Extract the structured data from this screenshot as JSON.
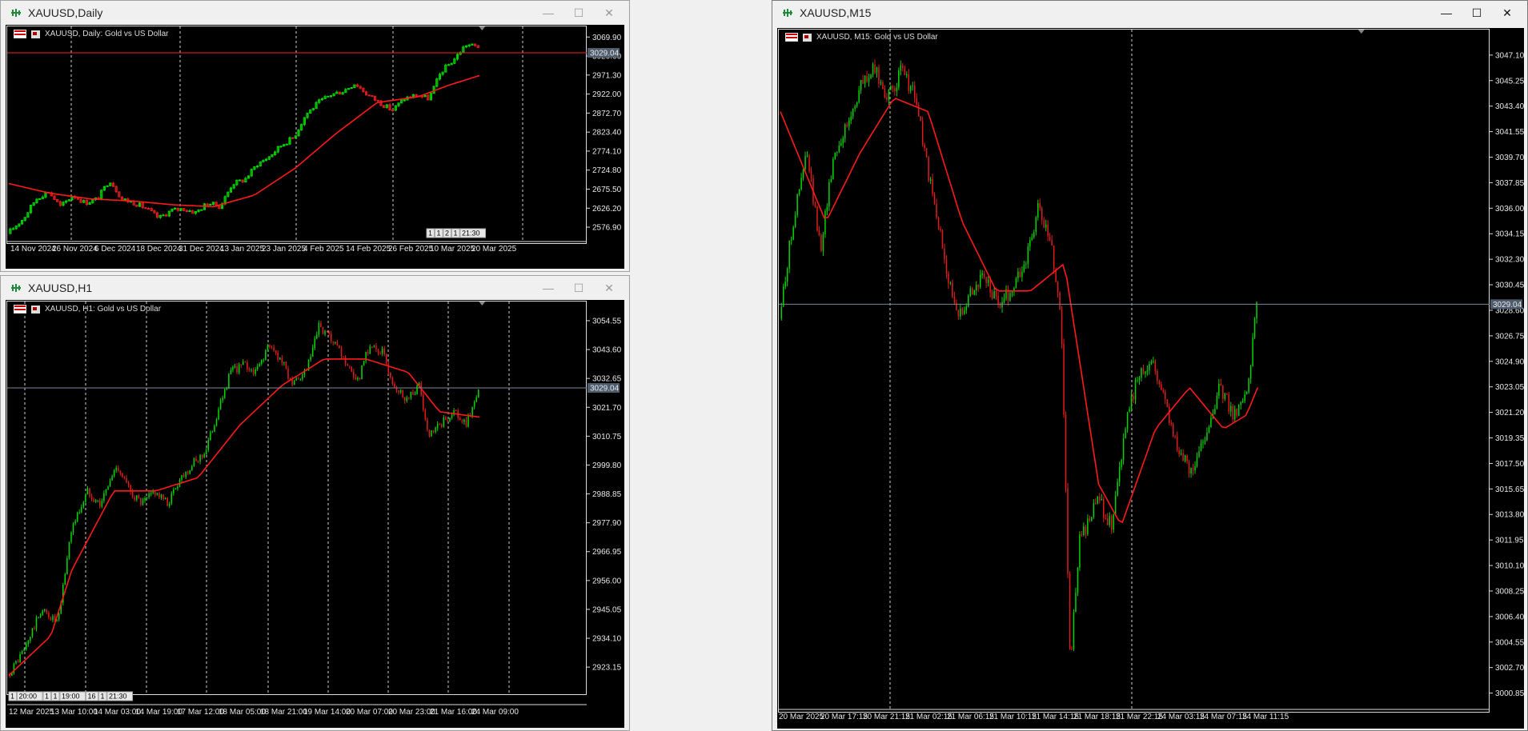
{
  "colors": {
    "bull": "#00d600",
    "bear": "#e21c1c",
    "ma": "#ff1a1a",
    "grid": "#d0d0d0",
    "price_line": "#7a8899",
    "price_box": "#4d5d6e"
  },
  "windows": [
    {
      "id": "daily",
      "title": "XAUUSD,Daily",
      "header": "XAUUSD, Daily:  Gold vs US Dollar",
      "active": false,
      "y_min": 2550,
      "y_max": 3085,
      "y_ticks": [
        "3069.90",
        "3020.60",
        "2971.30",
        "2922.00",
        "2872.70",
        "2823.40",
        "2774.10",
        "2724.80",
        "2675.50",
        "2626.20",
        "2576.90"
      ],
      "current_price": "3029.04",
      "price_line_color": "#ff2020",
      "x_labels": [
        "14 Nov 2024",
        "26 Nov 2024",
        "6 Dec 2024",
        "18 Dec 2024",
        "31 Dec 2024",
        "13 Jan 2025",
        "23 Jan 2025",
        "4 Feb 2025",
        "14 Feb 2025",
        "26 Feb 2025",
        "10 Mar 2025",
        "20 Mar 2025"
      ],
      "period_separators": [
        "1",
        "1",
        "2",
        "1",
        "21:30"
      ],
      "path": [
        [
          0,
          2560
        ],
        [
          8,
          2600
        ],
        [
          14,
          2650
        ],
        [
          20,
          2670
        ],
        [
          26,
          2630
        ],
        [
          32,
          2660
        ],
        [
          38,
          2640
        ],
        [
          44,
          2650
        ],
        [
          50,
          2700
        ],
        [
          56,
          2650
        ],
        [
          62,
          2640
        ],
        [
          68,
          2625
        ],
        [
          74,
          2600
        ],
        [
          80,
          2620
        ],
        [
          86,
          2625
        ],
        [
          92,
          2615
        ],
        [
          98,
          2640
        ],
        [
          104,
          2630
        ],
        [
          110,
          2690
        ],
        [
          116,
          2700
        ],
        [
          122,
          2740
        ],
        [
          128,
          2760
        ],
        [
          134,
          2790
        ],
        [
          140,
          2810
        ],
        [
          146,
          2870
        ],
        [
          152,
          2900
        ],
        [
          158,
          2920
        ],
        [
          164,
          2930
        ],
        [
          170,
          2950
        ],
        [
          176,
          2920
        ],
        [
          182,
          2900
        ],
        [
          188,
          2880
        ],
        [
          194,
          2910
        ],
        [
          200,
          2920
        ],
        [
          206,
          2910
        ],
        [
          212,
          2980
        ],
        [
          218,
          3010
        ],
        [
          224,
          3050
        ],
        [
          230,
          3045
        ]
      ],
      "ma_path": [
        [
          0,
          2690
        ],
        [
          20,
          2665
        ],
        [
          40,
          2650
        ],
        [
          60,
          2645
        ],
        [
          80,
          2635
        ],
        [
          100,
          2630
        ],
        [
          120,
          2660
        ],
        [
          140,
          2730
        ],
        [
          160,
          2820
        ],
        [
          180,
          2900
        ],
        [
          200,
          2915
        ],
        [
          215,
          2945
        ],
        [
          230,
          2970
        ]
      ]
    },
    {
      "id": "h1",
      "title": "XAUUSD,H1",
      "header": "XAUUSD, H1:  Gold vs US Dollar",
      "active": false,
      "y_min": 2915,
      "y_max": 3060,
      "y_ticks": [
        "3054.55",
        "3043.60",
        "3032.65",
        "3021.70",
        "3010.75",
        "2999.80",
        "2988.85",
        "2977.90",
        "2966.95",
        "2956.00",
        "2945.05",
        "2934.10",
        "2923.15"
      ],
      "current_price": "3029.04",
      "price_line_color": "#7a8899",
      "x_labels": [
        "12 Mar 2025",
        "13 Mar 10:00",
        "14 Mar 03:00",
        "14 Mar 19:00",
        "17 Mar 12:00",
        "18 Mar 05:00",
        "18 Mar 21:00",
        "19 Mar 14:00",
        "20 Mar 07:00",
        "20 Mar 23:00",
        "21 Mar 16:00",
        "24 Mar 09:00"
      ],
      "period_separators": [
        "1",
        "20:00",
        "1",
        "1",
        "19:00",
        "16",
        "1",
        "21:30"
      ],
      "path": [
        [
          0,
          2920
        ],
        [
          8,
          2930
        ],
        [
          16,
          2945
        ],
        [
          24,
          2940
        ],
        [
          30,
          2975
        ],
        [
          38,
          2990
        ],
        [
          44,
          2985
        ],
        [
          52,
          3000
        ],
        [
          58,
          2990
        ],
        [
          64,
          2985
        ],
        [
          70,
          2990
        ],
        [
          76,
          2985
        ],
        [
          82,
          2995
        ],
        [
          88,
          3000
        ],
        [
          94,
          3005
        ],
        [
          100,
          3020
        ],
        [
          106,
          3035
        ],
        [
          112,
          3038
        ],
        [
          118,
          3035
        ],
        [
          124,
          3045
        ],
        [
          130,
          3040
        ],
        [
          136,
          3030
        ],
        [
          142,
          3035
        ],
        [
          148,
          3052
        ],
        [
          154,
          3047
        ],
        [
          160,
          3040
        ],
        [
          166,
          3030
        ],
        [
          172,
          3045
        ],
        [
          178,
          3043
        ],
        [
          184,
          3030
        ],
        [
          190,
          3025
        ],
        [
          196,
          3030
        ],
        [
          200,
          3010
        ],
        [
          206,
          3015
        ],
        [
          212,
          3020
        ],
        [
          218,
          3015
        ],
        [
          224,
          3028
        ]
      ],
      "ma_path": [
        [
          0,
          2920
        ],
        [
          20,
          2935
        ],
        [
          30,
          2960
        ],
        [
          50,
          2990
        ],
        [
          70,
          2990
        ],
        [
          90,
          2995
        ],
        [
          110,
          3015
        ],
        [
          130,
          3030
        ],
        [
          150,
          3040
        ],
        [
          170,
          3040
        ],
        [
          190,
          3035
        ],
        [
          205,
          3020
        ],
        [
          224,
          3018
        ]
      ]
    },
    {
      "id": "m15",
      "title": "XAUUSD,M15",
      "header": "XAUUSD, M15:  Gold vs US Dollar",
      "active": true,
      "y_min": 2999.9,
      "y_max": 3048.6,
      "y_ticks": [
        "3047.10",
        "3045.25",
        "3043.40",
        "3041.55",
        "3039.70",
        "3037.85",
        "3036.00",
        "3034.15",
        "3032.30",
        "3030.45",
        "3028.60",
        "3026.75",
        "3024.90",
        "3023.05",
        "3021.20",
        "3019.35",
        "3017.50",
        "3015.65",
        "3013.80",
        "3011.95",
        "3010.10",
        "3008.25",
        "3006.40",
        "3004.55",
        "3002.70",
        "3000.85"
      ],
      "current_price": "3029.04",
      "price_line_color": "#7a8899",
      "x_labels": [
        "20 Mar 2025",
        "20 Mar 17:15",
        "20 Mar 21:15",
        "21 Mar 02:15",
        "21 Mar 06:15",
        "21 Mar 10:15",
        "21 Mar 14:15",
        "21 Mar 18:15",
        "21 Mar 22:15",
        "24 Mar 03:15",
        "24 Mar 07:15",
        "24 Mar 11:15"
      ],
      "period_separators": [],
      "path": [
        [
          0,
          3028
        ],
        [
          6,
          3035
        ],
        [
          12,
          3040
        ],
        [
          18,
          3033
        ],
        [
          24,
          3040
        ],
        [
          30,
          3042
        ],
        [
          36,
          3045
        ],
        [
          42,
          3046
        ],
        [
          48,
          3044
        ],
        [
          54,
          3046
        ],
        [
          60,
          3044
        ],
        [
          66,
          3038
        ],
        [
          72,
          3033
        ],
        [
          78,
          3028
        ],
        [
          84,
          3030
        ],
        [
          90,
          3031
        ],
        [
          96,
          3029
        ],
        [
          102,
          3030
        ],
        [
          108,
          3032
        ],
        [
          114,
          3036
        ],
        [
          120,
          3033
        ],
        [
          124,
          3028
        ],
        [
          128,
          3003
        ],
        [
          132,
          3012
        ],
        [
          136,
          3013
        ],
        [
          140,
          3015
        ],
        [
          146,
          3013
        ],
        [
          152,
          3020
        ],
        [
          158,
          3024
        ],
        [
          164,
          3025
        ],
        [
          170,
          3022
        ],
        [
          176,
          3018
        ],
        [
          182,
          3017
        ],
        [
          188,
          3020
        ],
        [
          194,
          3023
        ],
        [
          200,
          3021
        ],
        [
          206,
          3023
        ],
        [
          210,
          3029
        ]
      ],
      "ma_path": [
        [
          0,
          3043
        ],
        [
          20,
          3035
        ],
        [
          35,
          3040
        ],
        [
          50,
          3044
        ],
        [
          65,
          3043
        ],
        [
          80,
          3035
        ],
        [
          95,
          3030
        ],
        [
          110,
          3030
        ],
        [
          125,
          3032
        ],
        [
          140,
          3016
        ],
        [
          150,
          3013
        ],
        [
          165,
          3020
        ],
        [
          180,
          3023
        ],
        [
          195,
          3020
        ],
        [
          205,
          3021
        ],
        [
          210,
          3023
        ]
      ]
    }
  ]
}
